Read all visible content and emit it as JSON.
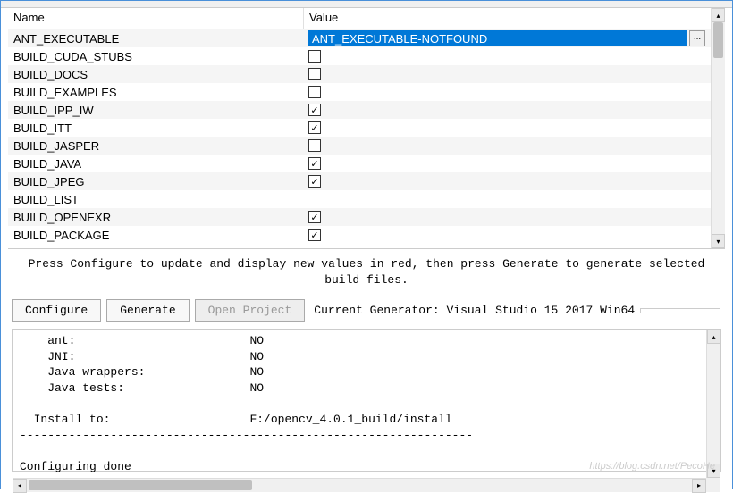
{
  "table": {
    "headers": {
      "name": "Name",
      "value": "Value"
    },
    "rows": [
      {
        "name": "ANT_EXECUTABLE",
        "type": "text",
        "value": "ANT_EXECUTABLE-NOTFOUND",
        "selected": true
      },
      {
        "name": "BUILD_CUDA_STUBS",
        "type": "bool",
        "value": false
      },
      {
        "name": "BUILD_DOCS",
        "type": "bool",
        "value": false
      },
      {
        "name": "BUILD_EXAMPLES",
        "type": "bool",
        "value": false
      },
      {
        "name": "BUILD_IPP_IW",
        "type": "bool",
        "value": true
      },
      {
        "name": "BUILD_ITT",
        "type": "bool",
        "value": true
      },
      {
        "name": "BUILD_JASPER",
        "type": "bool",
        "value": false
      },
      {
        "name": "BUILD_JAVA",
        "type": "bool",
        "value": true
      },
      {
        "name": "BUILD_JPEG",
        "type": "bool",
        "value": true
      },
      {
        "name": "BUILD_LIST",
        "type": "bool",
        "value": null
      },
      {
        "name": "BUILD_OPENEXR",
        "type": "bool",
        "value": true
      },
      {
        "name": "BUILD_PACKAGE",
        "type": "bool",
        "value": true
      }
    ]
  },
  "hint": "Press Configure to update and display new values in red, then press Generate to generate selected\nbuild files.",
  "buttons": {
    "configure": "Configure",
    "generate": "Generate",
    "open_project": "Open Project"
  },
  "generator": {
    "label": "Current Generator: Visual Studio 15 2017 Win64",
    "value": ""
  },
  "output": "    ant:                         NO\n    JNI:                         NO\n    Java wrappers:               NO\n    Java tests:                  NO\n\n  Install to:                    F:/opencv_4.0.1_build/install\n-----------------------------------------------------------------\n\nConfiguring done",
  "watermark": "https://blog.csdn.net/PecoHe"
}
